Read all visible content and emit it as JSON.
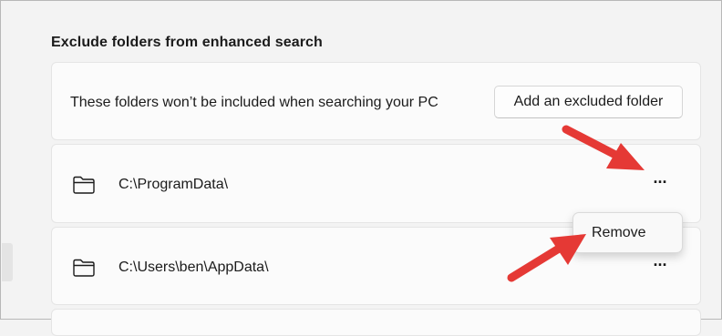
{
  "section": {
    "title": "Exclude folders from enhanced search"
  },
  "header_card": {
    "description": "These folders won’t be included when searching your PC",
    "add_button_label": "Add an excluded folder"
  },
  "folders": [
    {
      "path": "C:\\ProgramData\\",
      "more_label": "···"
    },
    {
      "path": "C:\\Users\\ben\\AppData\\",
      "more_label": "···"
    }
  ],
  "context_menu": {
    "items": [
      "Remove"
    ]
  },
  "colors": {
    "background": "#f3f3f3",
    "card": "#fbfbfb",
    "annotation_arrow": "#e53935"
  },
  "icons": {
    "folder": "folder-icon",
    "more": "more-options-icon"
  }
}
